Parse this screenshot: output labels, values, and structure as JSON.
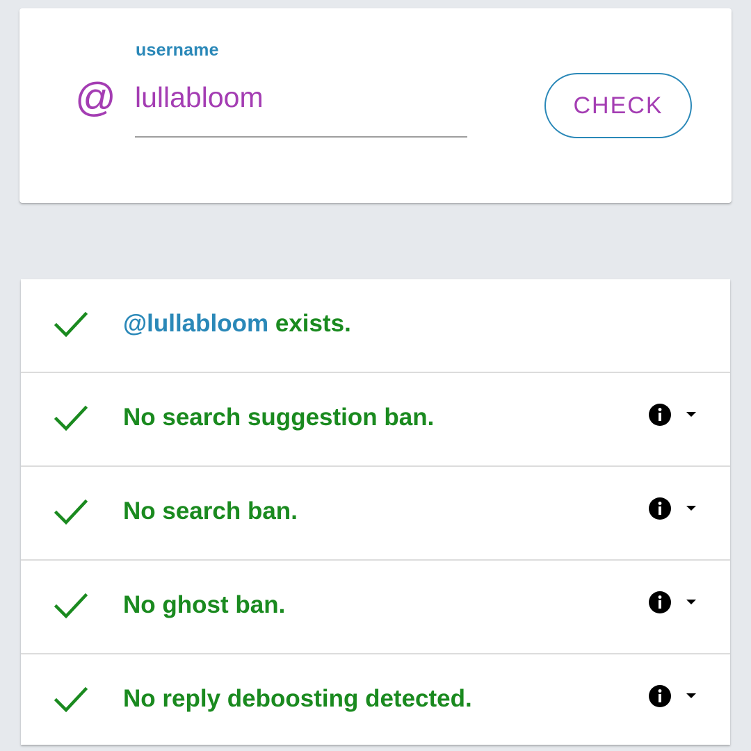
{
  "colors": {
    "accent_purple": "#a43db3",
    "accent_blue": "#2a88b8",
    "success_green": "#1a8a1f",
    "background": "#e6e9ed"
  },
  "search": {
    "at_symbol": "@",
    "label": "username",
    "value": "lullabloom",
    "button_label": "CHECK"
  },
  "results": [
    {
      "status_icon": "check-icon",
      "handle": "@lullabloom",
      "text": " exists.",
      "has_info": false
    },
    {
      "status_icon": "check-icon",
      "text": "No search suggestion ban.",
      "has_info": true,
      "info_icon": "info-icon",
      "expand_icon": "dropdown-arrow-icon"
    },
    {
      "status_icon": "check-icon",
      "text": "No search ban.",
      "has_info": true,
      "info_icon": "info-icon",
      "expand_icon": "dropdown-arrow-icon"
    },
    {
      "status_icon": "check-icon",
      "text": "No ghost ban.",
      "has_info": true,
      "info_icon": "info-icon",
      "expand_icon": "dropdown-arrow-icon"
    },
    {
      "status_icon": "check-icon",
      "text": "No reply deboosting detected.",
      "has_info": true,
      "info_icon": "info-icon",
      "expand_icon": "dropdown-arrow-icon"
    }
  ]
}
